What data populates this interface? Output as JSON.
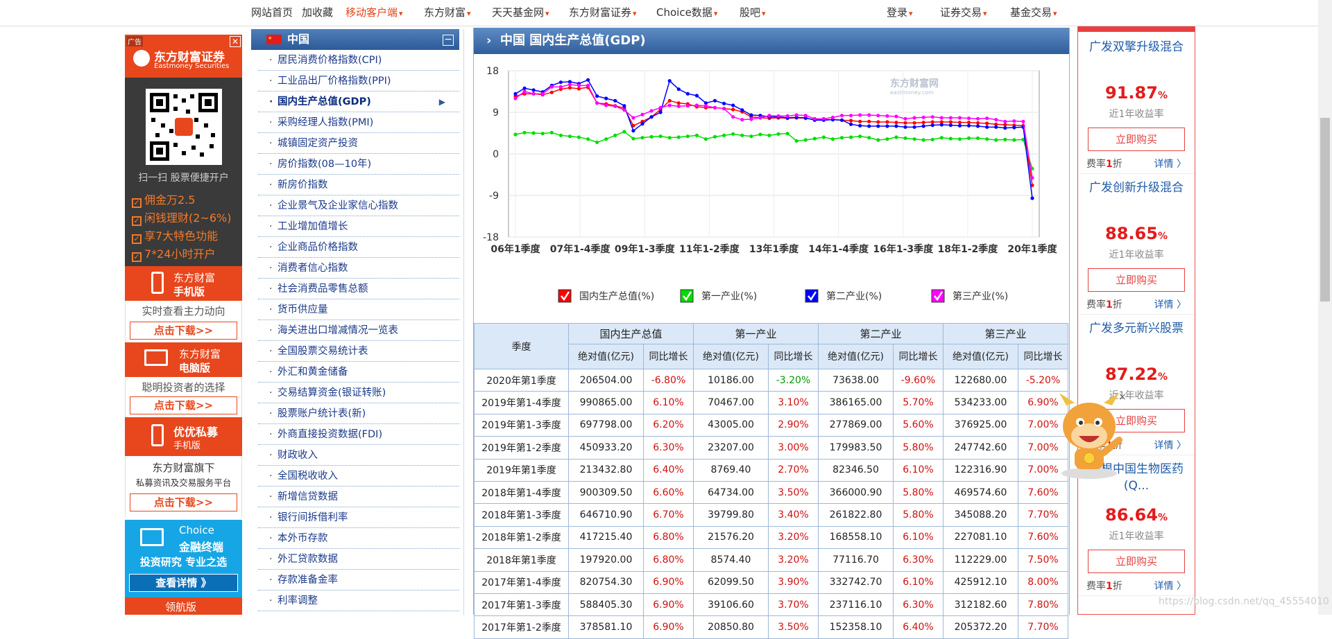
{
  "topnav": {
    "items": [
      {
        "label": "网站首页",
        "caret": false,
        "hot": false,
        "x": 362
      },
      {
        "label": "加收藏",
        "caret": false,
        "hot": false,
        "x": 435
      },
      {
        "label": "移动客户端",
        "caret": true,
        "hot": true,
        "x": 498
      },
      {
        "label": "东方财富",
        "caret": true,
        "hot": false,
        "x": 611
      },
      {
        "label": "天天基金网",
        "caret": true,
        "hot": false,
        "x": 709
      },
      {
        "label": "东方财富证券",
        "caret": true,
        "hot": false,
        "x": 820
      },
      {
        "label": "Choice数据",
        "caret": true,
        "hot": false,
        "x": 946
      },
      {
        "label": "股吧",
        "caret": true,
        "hot": false,
        "x": 1066
      },
      {
        "label": "登录",
        "caret": true,
        "hot": false,
        "x": 1278
      },
      {
        "label": "证券交易",
        "caret": true,
        "hot": false,
        "x": 1355
      },
      {
        "label": "基金交易",
        "caret": true,
        "hot": false,
        "x": 1456
      }
    ]
  },
  "left_ad": {
    "tag": "广告",
    "brand": "东方财富证券",
    "brand_en": "Eastmoney Securities",
    "scan_text": "扫一扫 股票便捷开户",
    "features": [
      "佣金万2.5",
      "闲钱理财(2~6%)",
      "享7大特色功能",
      "7*24小时开户"
    ],
    "mobile_title": "东方财富",
    "mobile_sub": "手机版",
    "mobile_slogan": "实时查看主力动向",
    "download": "点击下载>>",
    "pc_title": "东方财富",
    "pc_sub": "电脑版",
    "pc_slogan": "聪明投资者的选择",
    "private_title": "优优私募",
    "private_sub": "手机版",
    "private_slogan1": "东方财富旗下",
    "private_slogan2": "私募资讯及交易服务平台",
    "choice_title": "Choice",
    "choice_sub": "金融终端",
    "choice_slogan": "投资研究 专业之选",
    "choice_btn": "查看详情 》",
    "bottom": "领航版"
  },
  "menu": {
    "header": "中国",
    "items": [
      "居民消费价格指数(CPI)",
      "工业品出厂价格指数(PPI)",
      "国内生产总值(GDP)",
      "采购经理人指数(PMI)",
      "城镇固定资产投资",
      "房价指数(08—10年)",
      "新房价指数",
      "企业景气及企业家信心指数",
      "工业增加值增长",
      "企业商品价格指数",
      "消费者信心指数",
      "社会消费品零售总额",
      "货币供应量",
      "海关进出口增减情况一览表",
      "全国股票交易统计表",
      "外汇和黄金储备",
      "交易结算资金(银证转账)",
      "股票账户统计表(新)",
      "外商直接投资数据(FDI)",
      "财政收入",
      "全国税收收入",
      "新增信贷数据",
      "银行间拆借利率",
      "本外币存款",
      "外汇贷款数据",
      "存款准备金率",
      "利率调整"
    ],
    "active": 2
  },
  "content": {
    "title": "中国 国内生产总值(GDP)",
    "chart_logo": "东方财富网",
    "chart_logo_en": "eastmoney.com"
  },
  "chart_data": {
    "type": "line",
    "ylim": [
      -18,
      18
    ],
    "yticks": [
      18,
      9,
      0,
      -9,
      -18
    ],
    "xticks": [
      "06年1季度",
      "07年1-4季度",
      "09年1-3季度",
      "11年1-2季度",
      "13年1季度",
      "14年1-4季度",
      "16年1-3季度",
      "18年1-2季度",
      "20年1季度"
    ],
    "grid": true,
    "legend_position": "bottom",
    "series": [
      {
        "name": "国内生产总值(%)",
        "color": "#ff0000",
        "values": [
          12.5,
          13,
          13,
          12.8,
          13.3,
          14,
          14.3,
          14.1,
          14.4,
          11,
          10.8,
          10.4,
          9.9,
          6.1,
          7,
          8,
          9.6,
          11.5,
          11,
          10.8,
          10.2,
          10,
          10,
          9.8,
          9.6,
          9.1,
          8,
          7.8,
          7.7,
          7.8,
          7.7,
          7.8,
          7.7,
          7.4,
          7.4,
          7.4,
          7.3,
          7.2,
          7,
          7,
          6.9,
          6.9,
          6.8,
          6.7,
          6.7,
          6.8,
          6.9,
          6.9,
          6.9,
          6.8,
          6.8,
          6.7,
          6.6,
          6.4,
          6.3,
          6.2,
          6.1,
          -6.8
        ]
      },
      {
        "name": "第一产业(%)",
        "color": "#00dd00",
        "values": [
          4.2,
          4.6,
          4.5,
          4.4,
          4.6,
          4,
          3.8,
          3.6,
          3.2,
          2.5,
          3.2,
          4,
          4.8,
          3.3,
          3.5,
          3.7,
          3.8,
          3.5,
          3.6,
          3.8,
          4,
          3.2,
          3.7,
          4,
          4.3,
          4,
          3.8,
          4.2,
          4,
          4.3,
          4.4,
          2.8,
          3,
          3.3,
          3.6,
          3.2,
          3.5,
          3.6,
          3.8,
          3.5,
          3,
          3.2,
          3.6,
          3.4,
          3.2,
          3,
          3.1,
          3.5,
          3.3,
          3.2,
          3.4,
          3.4,
          3.2,
          3,
          3.1,
          3,
          3.1,
          -3.2
        ]
      },
      {
        "name": "第二产业(%)",
        "color": "#0000ff",
        "values": [
          13,
          14.2,
          13.8,
          13.4,
          14.8,
          15.5,
          15.6,
          15.2,
          16,
          12.5,
          12,
          11.5,
          10.4,
          5,
          6.5,
          8,
          9,
          15.8,
          14,
          13,
          12.6,
          11,
          11.5,
          10.9,
          10.5,
          9.5,
          8.4,
          8.3,
          8,
          8,
          7.8,
          7.9,
          7.8,
          7.3,
          7.3,
          7.4,
          7.3,
          6.4,
          6.1,
          6,
          6,
          6,
          6,
          5.8,
          5.8,
          6,
          6.2,
          6.3,
          6.2,
          6.1,
          6.1,
          6,
          5.8,
          5.8,
          5.6,
          5.7,
          5.8,
          -9.6
        ]
      },
      {
        "name": "第三产业(%)",
        "color": "#ff00ff",
        "values": [
          12,
          13.5,
          13,
          13,
          14.5,
          14.5,
          15,
          14.8,
          14.8,
          11,
          10.5,
          10.3,
          9.5,
          7.8,
          8.5,
          9.3,
          10,
          10.5,
          10.3,
          10.4,
          10.5,
          10.4,
          10,
          9.8,
          8,
          7.4,
          7.5,
          7.8,
          8.3,
          8.2,
          8.2,
          8.4,
          8.3,
          7.6,
          7.6,
          7.9,
          8.3,
          8.3,
          8.4,
          8.4,
          8.3,
          8.2,
          8.1,
          7.6,
          7.8,
          7.9,
          8,
          7.8,
          7.8,
          7.8,
          7.7,
          7.6,
          7.7,
          7.4,
          7,
          7.1,
          7,
          -5.2
        ]
      }
    ]
  },
  "table": {
    "header_quarter": "季度",
    "groups": [
      "国内生产总值",
      "第一产业",
      "第二产业",
      "第三产业"
    ],
    "sub_abs": "绝对值(亿元)",
    "sub_pct": "同比增长",
    "rows": [
      [
        "2020年第1季度",
        "206504.00",
        "-6.80%",
        "10186.00",
        "-3.20%",
        "73638.00",
        "-9.60%",
        "122680.00",
        "-5.20%"
      ],
      [
        "2019年第1-4季度",
        "990865.00",
        "6.10%",
        "70467.00",
        "3.10%",
        "386165.00",
        "5.70%",
        "534233.00",
        "6.90%"
      ],
      [
        "2019年第1-3季度",
        "697798.00",
        "6.20%",
        "43005.00",
        "2.90%",
        "277869.00",
        "5.60%",
        "376925.00",
        "7.00%"
      ],
      [
        "2019年第1-2季度",
        "450933.20",
        "6.30%",
        "23207.00",
        "3.00%",
        "179983.50",
        "5.80%",
        "247742.60",
        "7.00%"
      ],
      [
        "2019年第1季度",
        "213432.80",
        "6.40%",
        "8769.40",
        "2.70%",
        "82346.50",
        "6.10%",
        "122316.90",
        "7.00%"
      ],
      [
        "2018年第1-4季度",
        "900309.50",
        "6.60%",
        "64734.00",
        "3.50%",
        "366000.90",
        "5.80%",
        "469574.60",
        "7.60%"
      ],
      [
        "2018年第1-3季度",
        "646710.90",
        "6.70%",
        "39799.80",
        "3.40%",
        "261822.80",
        "5.80%",
        "345088.20",
        "7.70%"
      ],
      [
        "2018年第1-2季度",
        "417215.40",
        "6.80%",
        "21576.20",
        "3.20%",
        "168558.10",
        "6.10%",
        "227081.10",
        "7.60%"
      ],
      [
        "2018年第1季度",
        "197920.00",
        "6.80%",
        "8574.40",
        "3.20%",
        "77116.70",
        "6.30%",
        "112229.00",
        "7.50%"
      ],
      [
        "2017年第1-4季度",
        "820754.30",
        "6.90%",
        "62099.50",
        "3.90%",
        "332742.70",
        "6.10%",
        "425912.10",
        "8.00%"
      ],
      [
        "2017年第1-3季度",
        "588405.30",
        "6.90%",
        "39106.60",
        "3.70%",
        "237116.10",
        "6.30%",
        "312182.60",
        "7.80%"
      ],
      [
        "2017年第1-2季度",
        "378581.10",
        "6.90%",
        "20850.80",
        "3.50%",
        "152358.10",
        "6.40%",
        "205372.20",
        "7.70%"
      ]
    ]
  },
  "right_ad": {
    "funds": [
      {
        "name": "广发双擎升级混合",
        "value": "91.87",
        "unit": "%",
        "label": "近1年收益率",
        "btn": "立即购买",
        "fee_pre": "费率",
        "fee_num": "1",
        "fee_post": "折",
        "detail": "详情 〉"
      },
      {
        "name": "广发创新升级混合",
        "value": "88.65",
        "unit": "%",
        "label": "近1年收益率",
        "btn": "立即购买",
        "fee_pre": "费率",
        "fee_num": "1",
        "fee_post": "折",
        "detail": "详情 〉"
      },
      {
        "name": "广发多元新兴股票",
        "value": "87.22",
        "unit": "%",
        "label": "近1年收益率",
        "btn": "立即购买",
        "fee_pre": "费率",
        "fee_num": "1",
        "fee_post": "折",
        "detail": "详情 〉"
      },
      {
        "name": "摩根中国生物医药(Q...",
        "value": "86.64",
        "unit": "%",
        "label": "近1年收益率",
        "btn": "立即购买",
        "fee_pre": "费率",
        "fee_num": "1",
        "fee_post": "折",
        "detail": "详情 〉"
      }
    ]
  },
  "watermark": "https://blog.csdn.net/qq_45554010"
}
